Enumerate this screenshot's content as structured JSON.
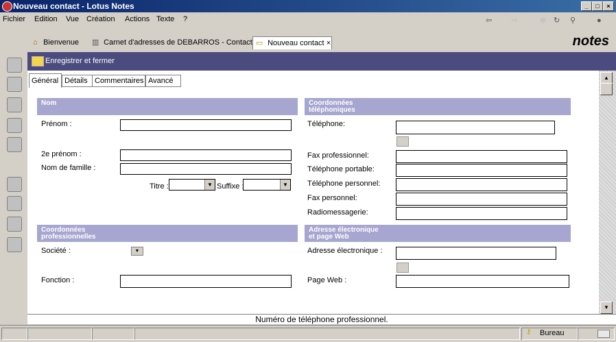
{
  "window": {
    "title": "Nouveau contact - Lotus Notes"
  },
  "menu": [
    "Fichier",
    "Edition",
    "Vue",
    "Création",
    "Actions",
    "Texte",
    "?"
  ],
  "doc_tabs": [
    {
      "label": "Bienvenue"
    },
    {
      "label": "Carnet d'adresses de DEBARROS - Contacts"
    },
    {
      "label": "Nouveau contact",
      "close": "×"
    }
  ],
  "brand": "notes",
  "action": {
    "save_close": "Enregistrer et fermer"
  },
  "form_tabs": [
    "Général",
    "Détails",
    "Commentaires",
    "Avancé"
  ],
  "sections": {
    "nom": "Nom",
    "telephoniques": "Coordonnées\ntéléphoniques",
    "professionnelles": "Coordonnées\nprofessionnelles",
    "adresse_web": "Adresse électronique\net page Web"
  },
  "labels": {
    "prenom": "Prénom :",
    "deuxieme_prenom": "2e prénom :",
    "nom_famille": "Nom de famille :",
    "titre": "Titre :",
    "suffixe": "Suffixe :",
    "telephone": "Téléphone:",
    "fax_pro": "Fax professionnel:",
    "tel_portable": "Téléphone portable:",
    "tel_perso": "Téléphone personnel:",
    "fax_perso": "Fax personnel:",
    "radio": "Radiomessagerie:",
    "societe": "Société :",
    "fonction": "Fonction :",
    "adresse_elec": "Adresse électronique :",
    "page_web": "Page Web :"
  },
  "status_message": "Numéro de téléphone professionnel.",
  "status": {
    "location": "Bureau"
  }
}
